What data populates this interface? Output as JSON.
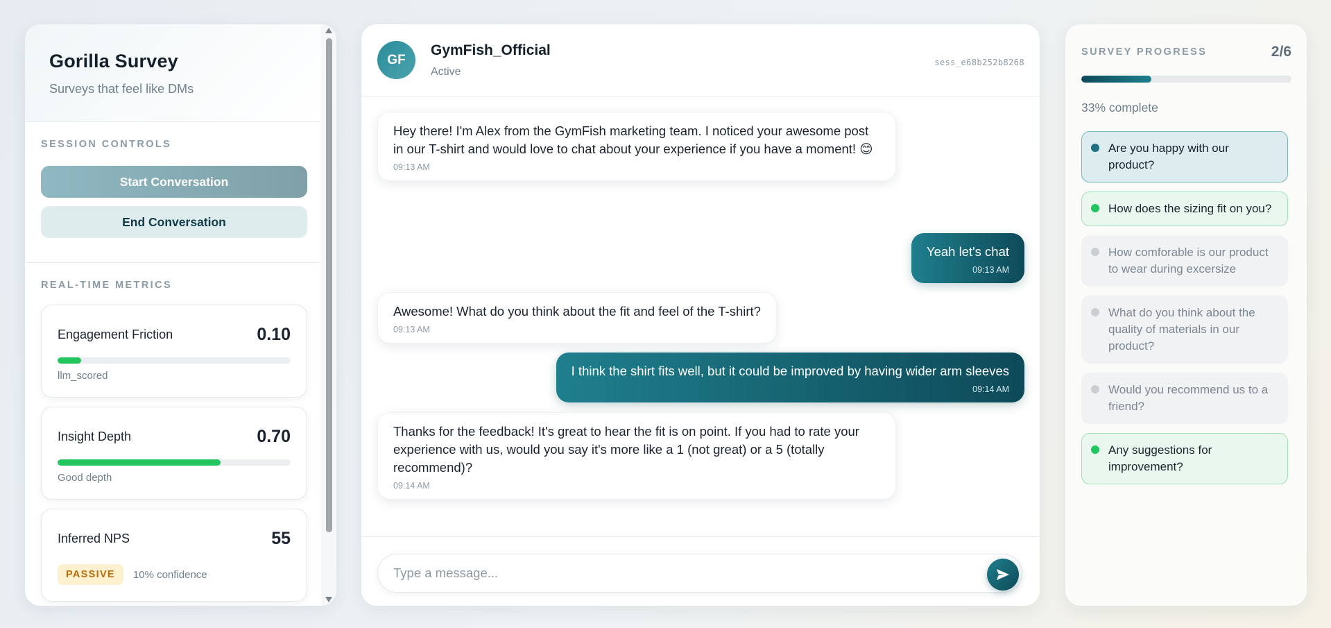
{
  "brand": {
    "title": "Gorilla Survey",
    "subtitle": "Surveys that feel like DMs"
  },
  "session_controls": {
    "label": "SESSION CONTROLS",
    "start_label": "Start Conversation",
    "end_label": "End Conversation"
  },
  "metrics": {
    "label": "REAL-TIME METRICS",
    "engagement": {
      "name": "Engagement Friction",
      "value": "0.10",
      "fraction": 0.1,
      "note": "llm_scored"
    },
    "insight": {
      "name": "Insight Depth",
      "value": "0.70",
      "fraction": 0.7,
      "note": "Good depth"
    },
    "nps": {
      "name": "Inferred NPS",
      "value": "55",
      "badge": "PASSIVE",
      "confidence": "10% confidence"
    }
  },
  "chat": {
    "avatar_initials": "GF",
    "contact_name": "GymFish_Official",
    "status": "Active",
    "session_id": "sess_e68b252b8268",
    "messages": [
      {
        "direction": "in",
        "text": "Hey there! I'm Alex from the GymFish marketing team. I noticed your awesome post in our T-shirt and would love to chat about your experience if you have a moment! 😊",
        "time": "09:13 AM"
      },
      {
        "direction": "out",
        "text": "Yeah let's chat",
        "time": "09:13 AM"
      },
      {
        "direction": "in",
        "text": "Awesome! What do you think about the fit and feel of the T-shirt?",
        "time": "09:13 AM"
      },
      {
        "direction": "out",
        "text": "I think the shirt fits well, but it could be improved by having wider arm sleeves",
        "time": "09:14 AM"
      },
      {
        "direction": "in",
        "text": "Thanks for the feedback! It's great to hear the fit is on point. If you had to rate your experience with us, would you say it's more like a 1 (not great) or a 5 (totally recommend)?",
        "time": "09:14 AM"
      }
    ],
    "input_placeholder": "Type a message..."
  },
  "survey": {
    "label": "SURVEY PROGRESS",
    "count": "2/6",
    "fraction": 0.333,
    "percent_text": "33% complete",
    "questions": [
      {
        "text": "Are you happy with our product?",
        "state": "current"
      },
      {
        "text": "How does the sizing fit on you?",
        "state": "done"
      },
      {
        "text": "How comforable is our product to wear during excersize",
        "state": "todo"
      },
      {
        "text": "What do you think about the quality of materials in our product?",
        "state": "todo"
      },
      {
        "text": "Would you recommend us to a friend?",
        "state": "todo"
      },
      {
        "text": "Any suggestions for improvement?",
        "state": "done"
      }
    ]
  },
  "colors": {
    "accent": "#1f7f8d",
    "accent_dark": "#0e4a59",
    "success": "#22c55e",
    "passive_badge_bg": "#fdf0cf",
    "passive_badge_text": "#b5700e"
  }
}
